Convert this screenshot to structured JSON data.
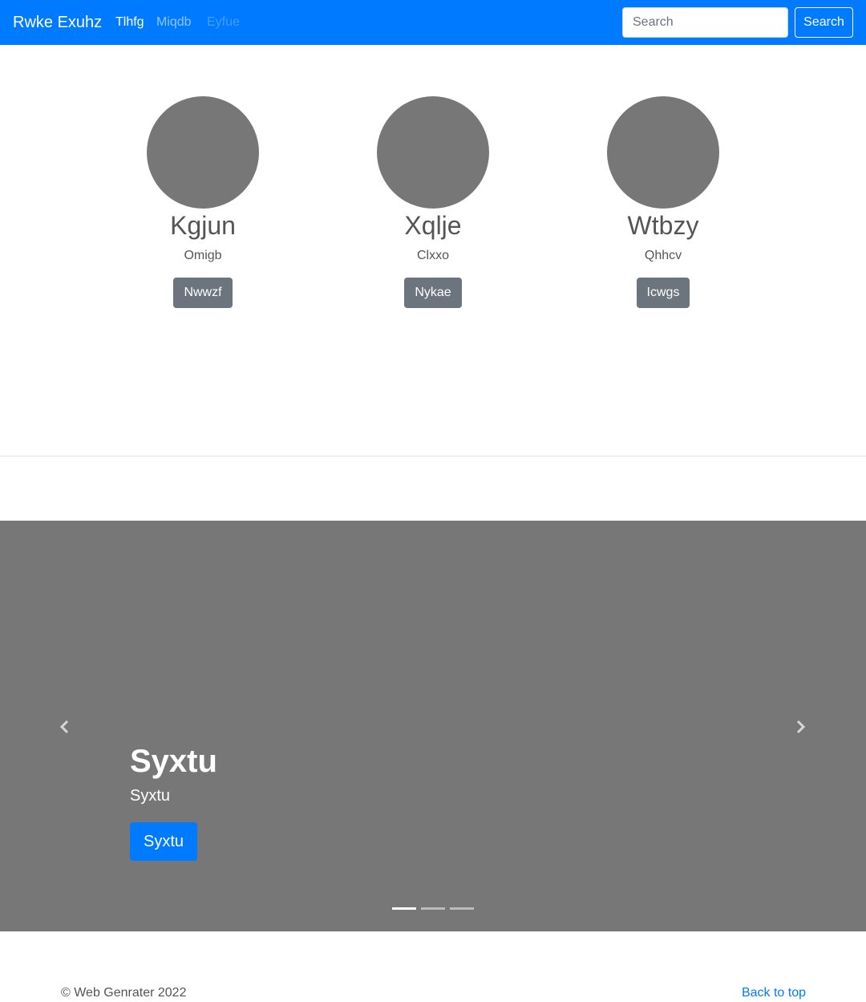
{
  "navbar": {
    "brand": "Rwke Exuhz",
    "links": [
      {
        "label": "Tlhfg",
        "state": "active"
      },
      {
        "label": "Miqdb",
        "state": "normal"
      },
      {
        "label": "Eyfue",
        "state": "disabled"
      }
    ],
    "search": {
      "placeholder": "Search",
      "value": "",
      "button_label": "Search"
    },
    "background_color": "#007bff"
  },
  "profiles": [
    {
      "name": "Kgjun",
      "subtitle": "Omigb",
      "button_label": "Nwwzf"
    },
    {
      "name": "Xqlje",
      "subtitle": "Clxxo",
      "button_label": "Nykae"
    },
    {
      "name": "Wtbzy",
      "subtitle": "Qhhcv",
      "button_label": "Icwgs"
    }
  ],
  "carousel": {
    "slide_title": "Syxtu",
    "slide_text": "Syxtu",
    "slide_button_label": "Syxtu",
    "prev_icon": "chevron-left-icon",
    "next_icon": "chevron-right-icon",
    "slide_count": 3,
    "active_slide": 1,
    "background_color": "#777777"
  },
  "footer": {
    "copyright": "© Web Genrater 2022",
    "back_to_top": "Back to top"
  }
}
